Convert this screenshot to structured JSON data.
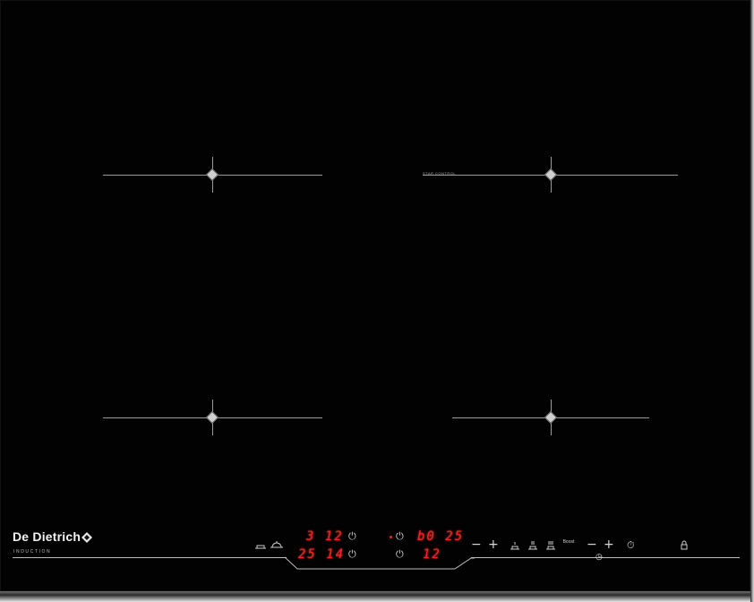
{
  "brand": {
    "name": "De Dietrich",
    "subtitle": "INDUCTION"
  },
  "zone_label": "STAR CONTROL",
  "displays": {
    "left_top": "3 12",
    "left_bottom": "25 14",
    "right_top": "b0 25",
    "right_bottom": "12"
  },
  "controls": {
    "minus": "−",
    "plus": "+",
    "power": "⏻",
    "timer": "⏱",
    "lock": "🔒",
    "clock": "◷",
    "boost_label": "Boost"
  },
  "colors": {
    "glass": "#020203",
    "display": "#ff1f1f",
    "lines": "#9a9a9a"
  }
}
